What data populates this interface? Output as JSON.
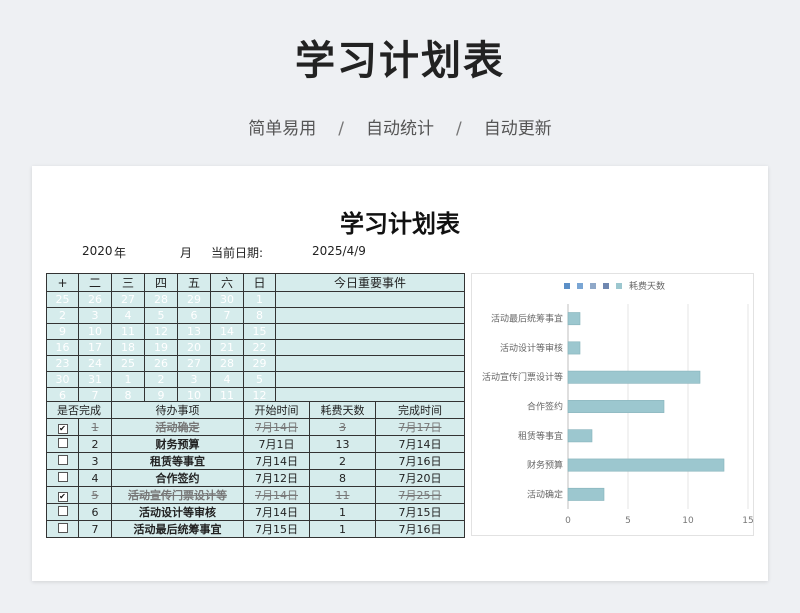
{
  "header": {
    "title": "学习计划表",
    "subtitle": [
      "简单易用",
      "自动统计",
      "自动更新"
    ],
    "separator": "/"
  },
  "sheet": {
    "title": "学习计划表",
    "year_value": "2020",
    "year_label": "年",
    "month_label": "月",
    "current_date_label": "当前日期:",
    "current_date_value": "2025/4/9"
  },
  "calendar": {
    "headers": [
      "+",
      "二",
      "三",
      "四",
      "五",
      "六",
      "日"
    ],
    "event_header": "今日重要事件",
    "weeks": [
      [
        "25",
        "26",
        "27",
        "28",
        "29",
        "30",
        "1"
      ],
      [
        "2",
        "3",
        "4",
        "5",
        "6",
        "7",
        "8"
      ],
      [
        "9",
        "10",
        "11",
        "12",
        "13",
        "14",
        "15"
      ],
      [
        "16",
        "17",
        "18",
        "19",
        "20",
        "21",
        "22"
      ],
      [
        "23",
        "24",
        "25",
        "26",
        "27",
        "28",
        "29"
      ],
      [
        "30",
        "31",
        "1",
        "2",
        "3",
        "4",
        "5"
      ],
      [
        "6",
        "7",
        "8",
        "9",
        "10",
        "11",
        "12"
      ]
    ]
  },
  "tasks": {
    "headers": [
      "是否完成",
      "待办事项",
      "开始时间",
      "耗费天数",
      "完成时间"
    ],
    "rows": [
      {
        "done": true,
        "index": "1",
        "name": "活动确定",
        "start": "7月14日",
        "days": "3",
        "end": "7月17日"
      },
      {
        "done": false,
        "index": "2",
        "name": "财务预算",
        "start": "7月1日",
        "days": "13",
        "end": "7月14日"
      },
      {
        "done": false,
        "index": "3",
        "name": "租赁等事宜",
        "start": "7月14日",
        "days": "2",
        "end": "7月16日"
      },
      {
        "done": false,
        "index": "4",
        "name": "合作签约",
        "start": "7月12日",
        "days": "8",
        "end": "7月20日"
      },
      {
        "done": true,
        "index": "5",
        "name": "活动宣传门票设计等",
        "start": "7月14日",
        "days": "11",
        "end": "7月25日"
      },
      {
        "done": false,
        "index": "6",
        "name": "活动设计等审核",
        "start": "7月14日",
        "days": "1",
        "end": "7月15日"
      },
      {
        "done": false,
        "index": "7",
        "name": "活动最后统筹事宜",
        "start": "7月15日",
        "days": "1",
        "end": "7月16日"
      }
    ]
  },
  "chart_data": {
    "type": "bar",
    "orientation": "horizontal",
    "categories": [
      "活动最后统筹事宜",
      "活动设计等审核",
      "活动宣传门票设计等",
      "合作签约",
      "租赁等事宜",
      "财务预算",
      "活动确定"
    ],
    "series": [
      {
        "name": "耗费天数",
        "values": [
          1,
          1,
          11,
          8,
          2,
          13,
          3
        ]
      }
    ],
    "xlim": [
      0,
      15
    ],
    "xticks": [
      "0",
      "5",
      "10",
      "15"
    ],
    "legend_position": "top",
    "grid": true,
    "bar_color": "#9cc7cf",
    "legend_swatch_colors": [
      "#5b8fc7",
      "#7aa6d4",
      "#8fa8c8",
      "#6f87b0",
      "#9cc7cf"
    ]
  }
}
